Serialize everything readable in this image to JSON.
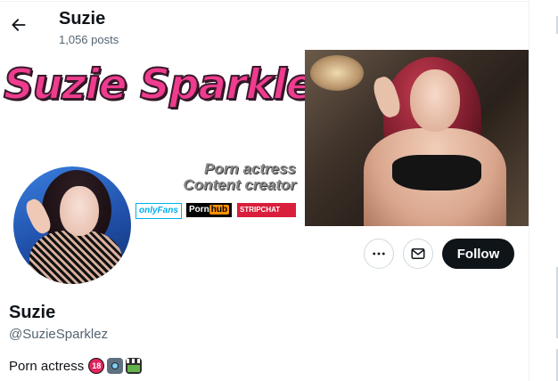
{
  "header": {
    "back_icon": "arrow-left-icon",
    "name": "Suzie",
    "posts_count": "1,056 posts"
  },
  "banner": {
    "title": "Suzie Sparklez",
    "tagline_1": "Porn actress",
    "tagline_2": "Content creator",
    "logos": [
      "onlyFans",
      "Porn",
      "hub",
      "STRIPCHAT"
    ]
  },
  "actions": {
    "more_icon": "ellipsis-icon",
    "message_icon": "envelope-icon",
    "follow_label": "Follow"
  },
  "profile": {
    "display_name": "Suzie",
    "handle": "@SuzieSparklez",
    "bio_text": "Porn actress",
    "bio_emojis": [
      "18",
      "camera-flash-emoji",
      "clapper-board-emoji"
    ]
  },
  "colors": {
    "primary_text": "#0f1419",
    "secondary_text": "#536471",
    "follow_bg": "#0f1419",
    "banner_title": "#f03c8e"
  }
}
